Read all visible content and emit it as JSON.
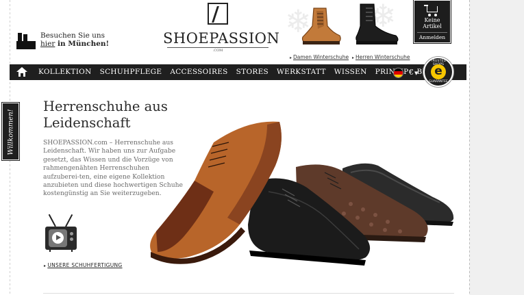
{
  "header": {
    "munich": {
      "line1": "Besuchen Sie uns",
      "line2_link": "hier",
      "line2_rest": " in München!"
    },
    "logo": {
      "name": "SHOEPASSION",
      "sub": ".COM"
    },
    "featured": [
      {
        "label": "Damen Winterschuhe",
        "color": "#c27a3a"
      },
      {
        "label": "Herren Winterschuhe",
        "color": "#1d1d1d"
      }
    ],
    "cart": {
      "line1": "Keine",
      "line2": "Artikel",
      "login": "Anmelden"
    }
  },
  "nav": {
    "items": [
      "KOLLEKTION",
      "SCHUHPFLEGE",
      "ACCESSOIRES",
      "STORES",
      "WERKSTATT",
      "WISSEN",
      "PRINZIP",
      "BLOG"
    ],
    "currency": "€"
  },
  "trusted_shops": {
    "top": "TRUSTED SHOPS",
    "badge": "e",
    "bottom": "GUARANTEE"
  },
  "welcome_tab": "Willkommen!",
  "main": {
    "headline": "Herrenschuhe aus Leidenschaft",
    "intro": "SHOEPASSION.com – Herrenschuhe aus Leidenschaft. Wir haben uns zur Aufgabe gesetzt, das Wissen und die Vorzüge von rahmengenähten Herrenschuhen aufzuberei-ten, eine eigene Kollektion anzubieten und diese hochwertigen Schuhe kostengünstig an Sie weiterzugeben.",
    "video_link": "UNSERE SCHUHFERTIGUNG"
  },
  "colors": {
    "nav_bg": "#1f1f1f",
    "accent_yellow": "#f7c600",
    "flag": [
      "#000000",
      "#dd0000",
      "#ffce00"
    ]
  }
}
